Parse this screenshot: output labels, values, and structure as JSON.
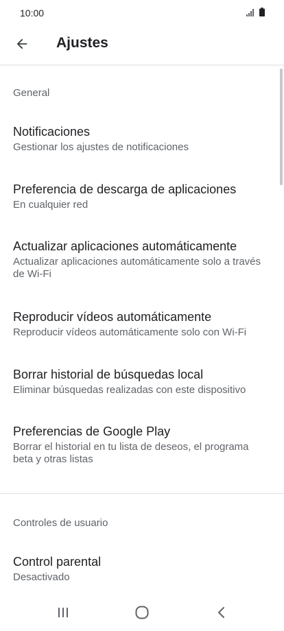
{
  "status_bar": {
    "time": "10:00"
  },
  "app_bar": {
    "title": "Ajustes",
    "back_icon": "arrow-back-icon"
  },
  "sections": [
    {
      "header": "General",
      "items": [
        {
          "title": "Notificaciones",
          "summary": "Gestionar los ajustes de notificaciones"
        },
        {
          "title": "Preferencia de descarga de aplicaciones",
          "summary": "En cualquier red"
        },
        {
          "title": "Actualizar aplicaciones automáticamente",
          "summary": "Actualizar aplicaciones automáticamente solo a través de Wi-Fi"
        },
        {
          "title": "Reproducir vídeos automáticamente",
          "summary": "Reproducir vídeos automáticamente solo con Wi-Fi"
        },
        {
          "title": "Borrar historial de búsquedas local",
          "summary": "Eliminar búsquedas realizadas con este dispositivo"
        },
        {
          "title": "Preferencias de Google Play",
          "summary": "Borrar el historial en tu lista de deseos, el programa beta y otras listas"
        }
      ]
    },
    {
      "header": "Controles de usuario",
      "items": [
        {
          "title": "Control parental",
          "summary": "Desactivado"
        }
      ]
    }
  ],
  "nav_bar": {
    "recents_icon": "recents-icon",
    "home_icon": "home-icon",
    "back_icon": "back-chevron-icon"
  },
  "colors": {
    "text_primary": "#202124",
    "text_secondary": "#5f6368",
    "divider": "#e0e0e0"
  }
}
